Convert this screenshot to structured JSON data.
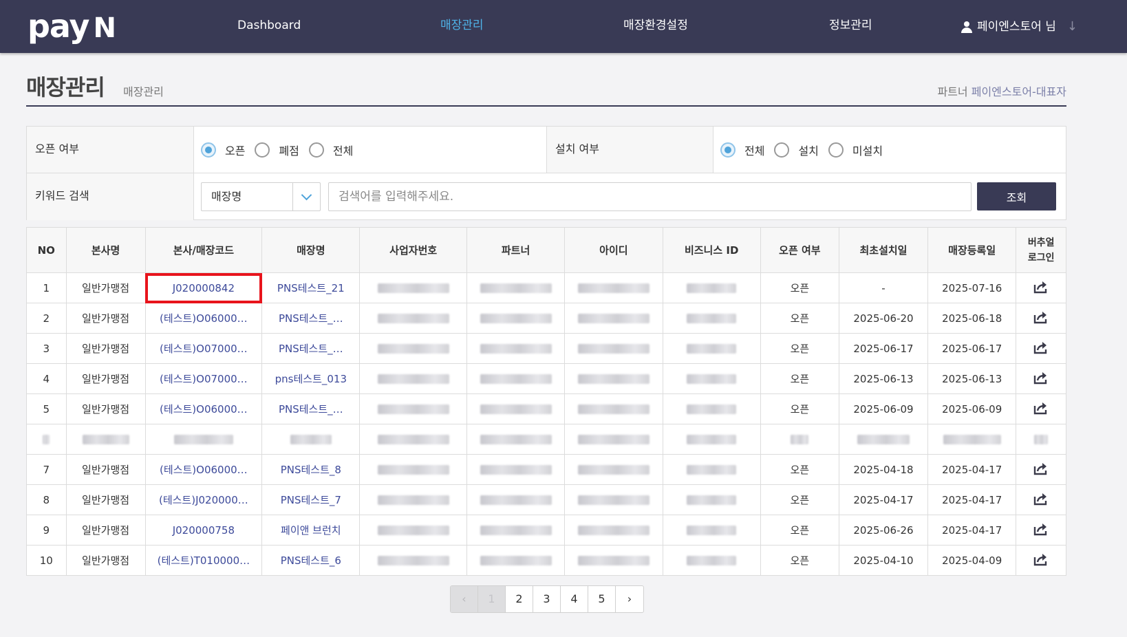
{
  "nav": {
    "logo": "pay",
    "logo_n": "N",
    "items": [
      "Dashboard",
      "매장관리",
      "매장환경설정",
      "정보관리"
    ],
    "user": "페이엔스토어 님"
  },
  "page": {
    "title": "매장관리",
    "subtitle": "매장관리",
    "partner_label": "파트너",
    "partner_name": "페이엔스토어-대표자"
  },
  "filter": {
    "open_label": "오픈 여부",
    "open_options": [
      "오픈",
      "폐점",
      "전체"
    ],
    "open_selected": "오픈",
    "install_label": "설치 여부",
    "install_options": [
      "전체",
      "설치",
      "미설치"
    ],
    "install_selected": "전체",
    "keyword_label": "키워드 검색",
    "keyword_select": "매장명",
    "search_placeholder": "검색어를 입력해주세요.",
    "search_button": "조회"
  },
  "table": {
    "headers": [
      "NO",
      "본사명",
      "본사/매장코드",
      "매장명",
      "사업자번호",
      "파트너",
      "아이디",
      "비즈니스 ID",
      "오픈 여부",
      "최초설치일",
      "매장등록일",
      "버추얼\n로그인"
    ],
    "rows": [
      {
        "no": "1",
        "hq": "일반가맹점",
        "code": "J020000842",
        "store": "PNS테스트_21",
        "open": "오픈",
        "first_install": "-",
        "reg_date": "2025-07-16"
      },
      {
        "no": "2",
        "hq": "일반가맹점",
        "code": "(테스트)O06000…",
        "store": "PNS테스트_…",
        "open": "오픈",
        "first_install": "2025-06-20",
        "reg_date": "2025-06-18"
      },
      {
        "no": "3",
        "hq": "일반가맹점",
        "code": "(테스트)O07000…",
        "store": "PNS테스트_…",
        "open": "오픈",
        "first_install": "2025-06-17",
        "reg_date": "2025-06-17"
      },
      {
        "no": "4",
        "hq": "일반가맹점",
        "code": "(테스트)O07000…",
        "store": "pns테스트_013",
        "open": "오픈",
        "first_install": "2025-06-13",
        "reg_date": "2025-06-13"
      },
      {
        "no": "5",
        "hq": "일반가맹점",
        "code": "(테스트)O06000…",
        "store": "PNS테스트_…",
        "open": "오픈",
        "first_install": "2025-06-09",
        "reg_date": "2025-06-09"
      },
      {
        "no": "",
        "hq": "",
        "code": "",
        "store": "",
        "open": "",
        "first_install": "",
        "reg_date": ""
      },
      {
        "no": "7",
        "hq": "일반가맹점",
        "code": "(테스트)O06000…",
        "store": "PNS테스트_8",
        "open": "오픈",
        "first_install": "2025-04-18",
        "reg_date": "2025-04-17"
      },
      {
        "no": "8",
        "hq": "일반가맹점",
        "code": "(테스트)J020000…",
        "store": "PNS테스트_7",
        "open": "오픈",
        "first_install": "2025-04-17",
        "reg_date": "2025-04-17"
      },
      {
        "no": "9",
        "hq": "일반가맹점",
        "code": "J020000758",
        "store": "페이앤 브런치",
        "open": "오픈",
        "first_install": "2025-06-26",
        "reg_date": "2025-04-17"
      },
      {
        "no": "10",
        "hq": "일반가맹점",
        "code": "(테스트)T010000…",
        "store": "PNS테스트_6",
        "open": "오픈",
        "first_install": "2025-04-10",
        "reg_date": "2025-04-09"
      }
    ]
  },
  "pagination": {
    "prev": "‹",
    "pages": [
      "1",
      "2",
      "3",
      "4",
      "5"
    ],
    "current": "1",
    "next": "›"
  },
  "icons": {
    "user": "user-icon",
    "arrow": "arrow-down-icon",
    "virtual_login": "share-out-icon",
    "dropdown": "chevron-down-icon"
  },
  "colors": {
    "nav_bg": "#393a55",
    "nav_active": "#4fb3e8",
    "link": "#3d4a9a",
    "highlight": "#e8141c"
  }
}
